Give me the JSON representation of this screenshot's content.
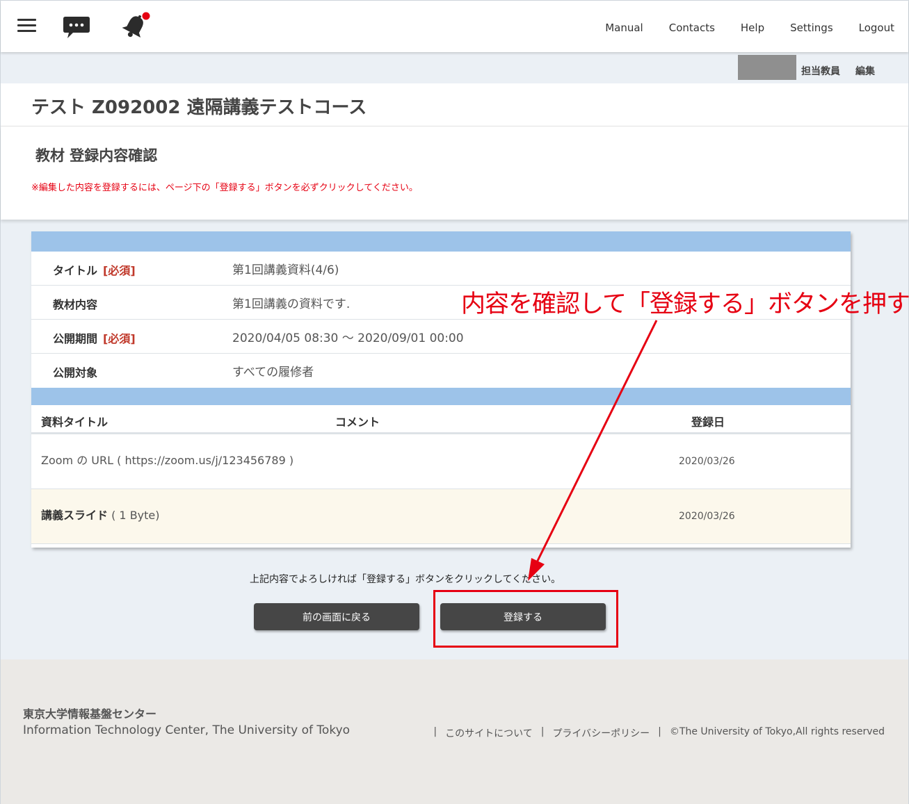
{
  "header": {
    "nav": [
      "Manual",
      "Contacts",
      "Help",
      "Settings",
      "Logout"
    ]
  },
  "teacher_bar": {
    "label": "担当教員",
    "edit": "編集"
  },
  "course": {
    "title": "テスト Z092002 遠隔講義テストコース"
  },
  "page": {
    "title": "教材 登録内容確認",
    "notice": "※編集した内容を登録するには、ページ下の「登録する」ボタンを必ずクリックしてください。"
  },
  "info": [
    {
      "label": "タイトル",
      "required": "[必須]",
      "value": "第1回講義資料(4/6)"
    },
    {
      "label": "教材内容",
      "required": "",
      "value": "第1回講義の資料です."
    },
    {
      "label": "公開期間",
      "required": "[必須]",
      "value": "2020/04/05 08:30 ～ 2020/09/01 00:00"
    },
    {
      "label": "公開対象",
      "required": "",
      "value": "すべての履修者"
    }
  ],
  "list": {
    "headers": {
      "title": "資料タイトル",
      "comment": "コメント",
      "date": "登録日"
    },
    "rows": [
      {
        "title_bold": "",
        "title": "Zoom の URL ( https://zoom.us/j/123456789 )",
        "date": "2020/03/26"
      },
      {
        "title_bold": "講義スライド",
        "title": " ( 1 Byte)",
        "date": "2020/03/26"
      }
    ]
  },
  "confirm_message": "上記内容でよろしければ「登録する」ボタンをクリックしてください。",
  "buttons": {
    "back": "前の画面に戻る",
    "register": "登録する"
  },
  "annotation": "内容を確認して「登録する」ボタンを押す",
  "footer": {
    "org_ja": "東京大学情報基盤センター",
    "org_en": "Information Technology Center, The University of Tokyo",
    "sep": "|",
    "about": "このサイトについて",
    "privacy": "プライバシーポリシー",
    "copyright": "©The University of Tokyo,All rights reserved"
  },
  "colors": {
    "accent_red": "#e60012",
    "band_blue": "#9dc3e9",
    "button_dark": "#464646"
  }
}
